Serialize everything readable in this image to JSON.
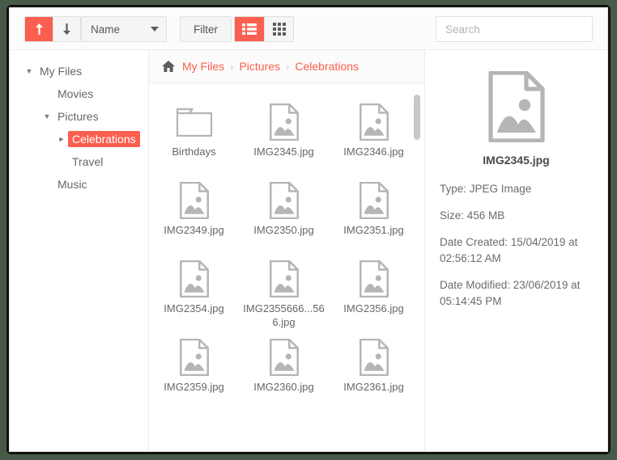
{
  "theme": {
    "accent": "#fb5f4f",
    "frame": "#111111",
    "desktop": "#475a47",
    "icon_gray": "#b5b5b5",
    "text": "#666666"
  },
  "toolbar": {
    "sort_ascending_icon": "arrow-up-icon",
    "sort_descending_icon": "arrow-down-icon",
    "sort_field_label": "Name",
    "sort_field_caret_icon": "chevron-down-icon",
    "filter_label": "Filter",
    "list_view_icon": "list-view-icon",
    "grid_view_icon": "grid-view-icon",
    "active_view": "list"
  },
  "search": {
    "value": "",
    "placeholder": "Search",
    "icon": "search-icon"
  },
  "sidebar": {
    "items": [
      {
        "label": "My Files",
        "level": 0,
        "caret": "▼",
        "selected": false
      },
      {
        "label": "Movies",
        "level": 1,
        "caret": "",
        "selected": false
      },
      {
        "label": "Pictures",
        "level": 1,
        "caret": "▼",
        "selected": false
      },
      {
        "label": "Celebrations",
        "level": 2,
        "caret": "►",
        "selected": true
      },
      {
        "label": "Travel",
        "level": 2,
        "caret": "",
        "selected": false
      },
      {
        "label": "Music",
        "level": 1,
        "caret": "",
        "selected": false
      }
    ]
  },
  "breadcrumb": {
    "home_icon": "home-icon",
    "separator": "›",
    "crumbs": [
      "My Files",
      "Pictures",
      "Celebrations"
    ]
  },
  "files": [
    {
      "name": "Birthdays",
      "type": "folder"
    },
    {
      "name": "IMG2345.jpg",
      "type": "image"
    },
    {
      "name": "IMG2346.jpg",
      "type": "image"
    },
    {
      "name": "IMG2349.jpg",
      "type": "image"
    },
    {
      "name": "IMG2350.jpg",
      "type": "image"
    },
    {
      "name": "IMG2351.jpg",
      "type": "image"
    },
    {
      "name": "IMG2354.jpg",
      "type": "image"
    },
    {
      "name": "IMG2355666...566.jpg",
      "type": "image"
    },
    {
      "name": "IMG2356.jpg",
      "type": "image"
    },
    {
      "name": "IMG2359.jpg",
      "type": "image"
    },
    {
      "name": "IMG2360.jpg",
      "type": "image"
    },
    {
      "name": "IMG2361.jpg",
      "type": "image"
    }
  ],
  "details": {
    "preview_icon": "image-file-icon",
    "file_name": "IMG2345.jpg",
    "meta": [
      "Type: JPEG Image",
      "Size: 456 MB",
      "Date Created: 15/04/2019 at 02:56:12 AM",
      "Date Modified: 23/06/2019 at 05:14:45 PM"
    ]
  }
}
